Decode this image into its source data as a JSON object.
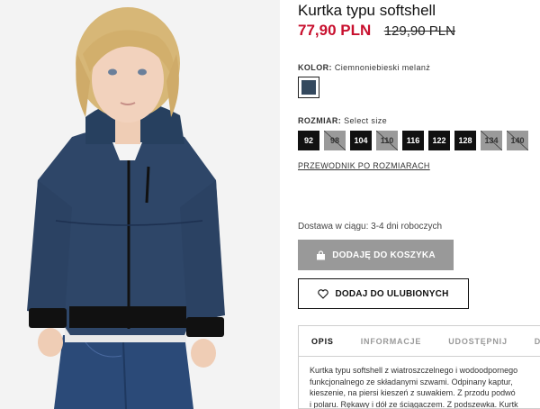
{
  "product": {
    "title": "Kurtka typu softshell",
    "price_sale": "77,90 PLN",
    "price_old": "129,90 PLN"
  },
  "color": {
    "label": "KOLOR:",
    "value": "Ciemnoniebieski melanż",
    "swatch_hex": "#34495e"
  },
  "size": {
    "label": "ROZMIAR:",
    "hint": "Select size",
    "options": [
      {
        "label": "92",
        "available": true
      },
      {
        "label": "98",
        "available": false
      },
      {
        "label": "104",
        "available": true
      },
      {
        "label": "110",
        "available": false
      },
      {
        "label": "116",
        "available": true
      },
      {
        "label": "122",
        "available": true
      },
      {
        "label": "128",
        "available": true
      },
      {
        "label": "134",
        "available": false
      },
      {
        "label": "140",
        "available": false
      }
    ],
    "guide_link": "PRZEWODNIK PO ROZMIARACH"
  },
  "delivery": "Dostawa w ciągu: 3-4 dni roboczych",
  "buttons": {
    "add_to_cart": "DODAJĘ DO KOSZYKA",
    "add_to_favorites": "DODAJ DO ULUBIONYCH"
  },
  "tabs": [
    "OPIS",
    "INFORMACJE",
    "UDOSTĘPNIJ",
    "DO"
  ],
  "description_lines": [
    "Kurtka typu softshell z wiatroszczelnego i wodoodpornego",
    "funkcjonalnego ze składanymi szwami. Odpinany kaptur,",
    "kieszenie, na piersi kieszeń z suwakiem. Z przodu podwó",
    "i polaru. Rękawy i dół ze ściągaczem. Z podszewka. Kurtk"
  ],
  "colors": {
    "sale": "#c8102e",
    "cart_button": "#999999",
    "unavailable_size": "#9a9a9a"
  }
}
